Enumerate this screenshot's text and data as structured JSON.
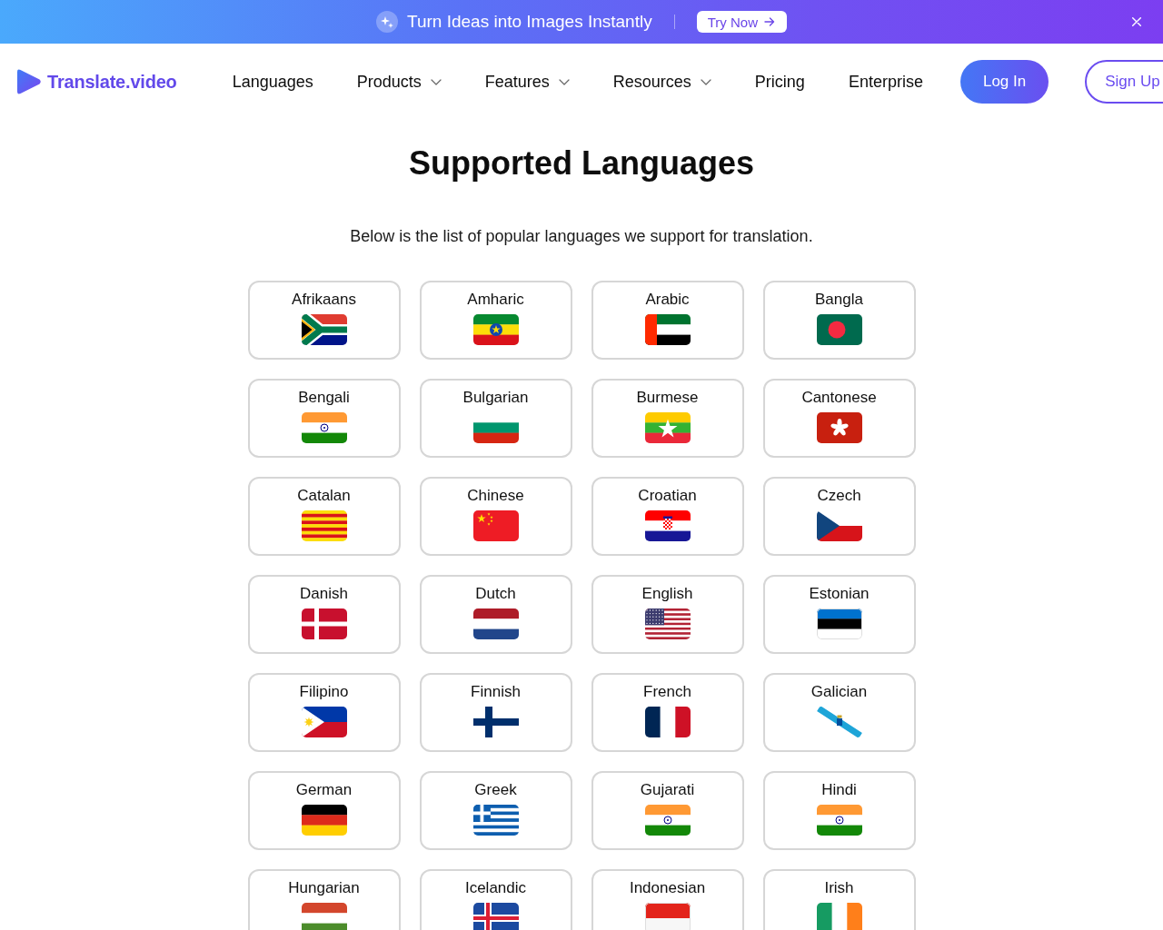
{
  "banner": {
    "text": "Turn Ideas into Images Instantly",
    "button": "Try Now"
  },
  "nav": {
    "logo": "Translate.video",
    "links": [
      {
        "label": "Languages",
        "kind": "link"
      },
      {
        "label": "Products",
        "kind": "menu"
      },
      {
        "label": "Features",
        "kind": "menu"
      },
      {
        "label": "Resources",
        "kind": "menu"
      },
      {
        "label": "Pricing",
        "kind": "link"
      },
      {
        "label": "Enterprise",
        "kind": "link"
      }
    ],
    "login": "Log In",
    "signup": "Sign Up"
  },
  "heading": "Supported Languages",
  "subtitle": "Below is the list of popular languages we support for translation.",
  "languages": [
    {
      "name": "Afrikaans",
      "kind": "za"
    },
    {
      "name": "Amharic",
      "kind": "et"
    },
    {
      "name": "Arabic",
      "kind": "ae"
    },
    {
      "name": "Bangla",
      "kind": "bd"
    },
    {
      "name": "Bengali",
      "kind": "in"
    },
    {
      "name": "Bulgarian",
      "kind": "bg"
    },
    {
      "name": "Burmese",
      "kind": "mm"
    },
    {
      "name": "Cantonese",
      "kind": "hk"
    },
    {
      "name": "Catalan",
      "kind": "cat"
    },
    {
      "name": "Chinese",
      "kind": "cn"
    },
    {
      "name": "Croatian",
      "kind": "hr"
    },
    {
      "name": "Czech",
      "kind": "cz"
    },
    {
      "name": "Danish",
      "kind": "dk"
    },
    {
      "name": "Dutch",
      "kind": "nl"
    },
    {
      "name": "English",
      "kind": "us"
    },
    {
      "name": "Estonian",
      "kind": "ee"
    },
    {
      "name": "Filipino",
      "kind": "ph"
    },
    {
      "name": "Finnish",
      "kind": "fi"
    },
    {
      "name": "French",
      "kind": "fr"
    },
    {
      "name": "Galician",
      "kind": "gal"
    },
    {
      "name": "German",
      "kind": "de"
    },
    {
      "name": "Greek",
      "kind": "gr"
    },
    {
      "name": "Gujarati",
      "kind": "in"
    },
    {
      "name": "Hindi",
      "kind": "in"
    },
    {
      "name": "Hungarian",
      "kind": "hu"
    },
    {
      "name": "Icelandic",
      "kind": "is"
    },
    {
      "name": "Indonesian",
      "kind": "id"
    },
    {
      "name": "Irish",
      "kind": "ie"
    }
  ]
}
